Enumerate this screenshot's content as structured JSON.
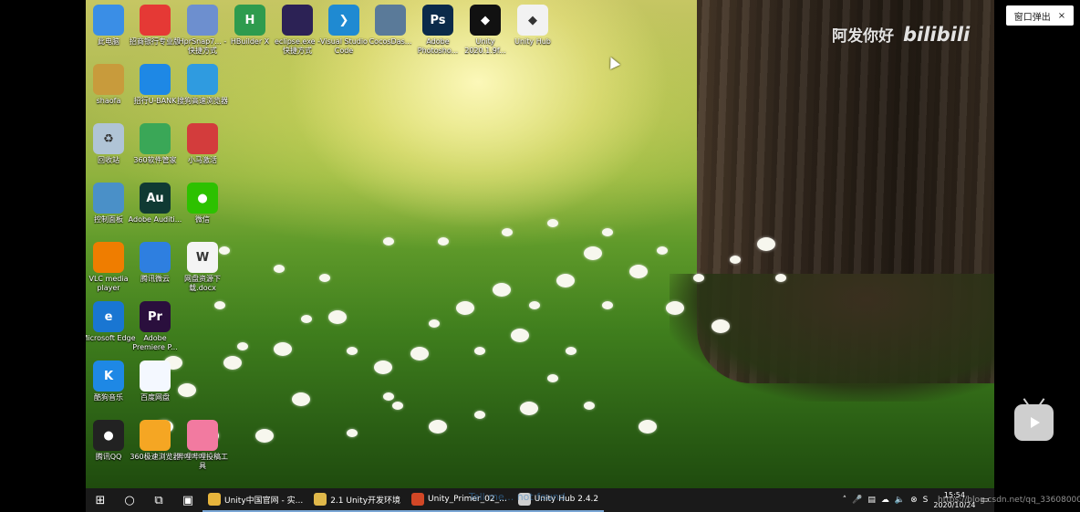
{
  "desktop_icons": [
    {
      "label": "此电脑",
      "icon": "computer-icon",
      "color": "#3a8ee6"
    },
    {
      "label": "招商银行专业版",
      "icon": "cmb-bank-icon",
      "color": "#e53935"
    },
    {
      "label": "HprSnap7... - 快捷方式",
      "icon": "hprsnap-icon",
      "color": "#6d8fcf"
    },
    {
      "label": "HBuilder X",
      "icon": "hbuilder-icon",
      "color": "#2e9b4e"
    },
    {
      "label": "eclipse.exe - 快捷方式",
      "icon": "eclipse-icon",
      "color": "#2c2255"
    },
    {
      "label": "Visual Studio Code",
      "icon": "vscode-icon",
      "color": "#1f8ad2"
    },
    {
      "label": "CocosDas...",
      "icon": "cocos-icon",
      "color": "#5a7a99"
    },
    {
      "label": "Adobe Photosho...",
      "icon": "photoshop-icon",
      "color": "#0b2a4a"
    },
    {
      "label": "Unity 2020.1.9f...",
      "icon": "unity-icon",
      "color": "#111111"
    },
    {
      "label": "Unity Hub",
      "icon": "unity-hub-icon",
      "color": "#f2f2f2"
    },
    {
      "label": "shaofa",
      "icon": "user-folder-icon",
      "color": "#c89b3c"
    },
    {
      "label": "招行U-BANK",
      "icon": "ubank-icon",
      "color": "#1e88e5"
    },
    {
      "label": "搜狗高速浏览器",
      "icon": "sogou-browser-icon",
      "color": "#2f9be0"
    },
    {
      "label": "回收站",
      "icon": "recycle-bin-icon",
      "color": "#b0c4d6"
    },
    {
      "label": "360软件管家",
      "icon": "360-manager-icon",
      "color": "#3aa757"
    },
    {
      "label": "小马激活",
      "icon": "activator-icon",
      "color": "#d33c3c"
    },
    {
      "label": "控制面板",
      "icon": "control-panel-icon",
      "color": "#4a90c8"
    },
    {
      "label": "Adobe Auditi...",
      "icon": "audition-icon",
      "color": "#103a33"
    },
    {
      "label": "微信",
      "icon": "wechat-icon",
      "color": "#2dc100"
    },
    {
      "label": "VLC media player",
      "icon": "vlc-icon",
      "color": "#ef7d00"
    },
    {
      "label": "腾讯微云",
      "icon": "weiyun-icon",
      "color": "#2e7fe0"
    },
    {
      "label": "网盘资源下载.docx",
      "icon": "word-doc-icon",
      "color": "#f4f4f4"
    },
    {
      "label": "Microsoft Edge",
      "icon": "edge-icon",
      "color": "#1976d2"
    },
    {
      "label": "Adobe Premiere P...",
      "icon": "premiere-icon",
      "color": "#2a0f3d"
    },
    {
      "label": "酷狗音乐",
      "icon": "kugou-icon",
      "color": "#1e88e5"
    },
    {
      "label": "百度网盘",
      "icon": "baidu-netdisk-icon",
      "color": "#f4f8ff"
    },
    {
      "label": "腾讯QQ",
      "icon": "qq-icon",
      "color": "#222222"
    },
    {
      "label": "360极速浏览器",
      "icon": "360-browser-icon",
      "color": "#f5a623"
    },
    {
      "label": "哔哩哔哩投稿工具",
      "icon": "bilibili-upload-icon",
      "color": "#f27aa0"
    }
  ],
  "icon_glyphs": {
    "vscode-icon": "❯",
    "photoshop-icon": "Ps",
    "premiere-icon": "Pr",
    "audition-icon": "Au",
    "hbuilder-icon": "H",
    "edge-icon": "e",
    "kugou-icon": "K",
    "unity-icon": "◆",
    "unity-hub-icon": "◆",
    "word-doc-icon": "W",
    "recycle-bin-icon": "♻",
    "wechat-icon": "●",
    "qq-icon": "●"
  },
  "watermark": {
    "text": "阿发你好",
    "logo": "bilibili"
  },
  "popup_button": {
    "label": "窗口弹出",
    "close": "×"
  },
  "taskbar": {
    "apps": [
      {
        "label": "Unity中国官网 - 实...",
        "icon": "chrome-icon",
        "color": "#e8b53c"
      },
      {
        "label": "2.1 Unity开发环境",
        "icon": "folder-icon",
        "color": "#e0b84a"
      },
      {
        "label": "Unity_Primer_02_...",
        "icon": "powerpoint-icon",
        "color": "#d24726"
      },
      {
        "label": "Unity Hub 2.4.2",
        "icon": "unity-hub-icon",
        "color": "#cfcfcf"
      }
    ],
    "search_overlay_text": "Tell me... not found",
    "clock_time": "15:54",
    "clock_date": "2020/10/24"
  },
  "csdn_watermark": "https://blog.csdn.net/qq_33608000"
}
